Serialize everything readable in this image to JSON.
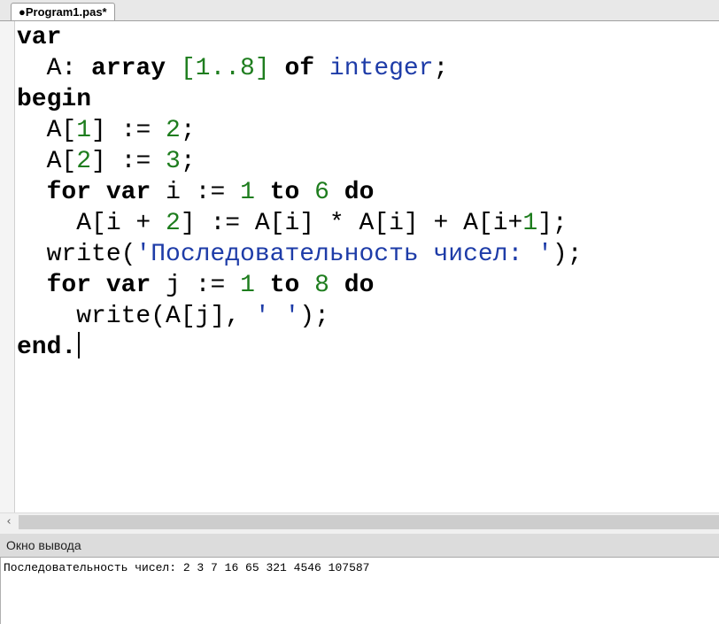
{
  "tab": {
    "title": "●Program1.pas*"
  },
  "code_lines": [
    [
      {
        "t": "var",
        "c": "kw"
      }
    ],
    [
      {
        "t": "  A: ",
        "c": ""
      },
      {
        "t": "array",
        "c": "kw"
      },
      {
        "t": " ",
        "c": ""
      },
      {
        "t": "[1..8]",
        "c": "num"
      },
      {
        "t": " ",
        "c": ""
      },
      {
        "t": "of",
        "c": "kw"
      },
      {
        "t": " ",
        "c": ""
      },
      {
        "t": "integer",
        "c": "typ"
      },
      {
        "t": ";",
        "c": ""
      }
    ],
    [
      {
        "t": "begin",
        "c": "kw"
      }
    ],
    [
      {
        "t": "  A[",
        "c": ""
      },
      {
        "t": "1",
        "c": "num"
      },
      {
        "t": "] := ",
        "c": ""
      },
      {
        "t": "2",
        "c": "num"
      },
      {
        "t": ";",
        "c": ""
      }
    ],
    [
      {
        "t": "  A[",
        "c": ""
      },
      {
        "t": "2",
        "c": "num"
      },
      {
        "t": "] := ",
        "c": ""
      },
      {
        "t": "3",
        "c": "num"
      },
      {
        "t": ";",
        "c": ""
      }
    ],
    [
      {
        "t": "  ",
        "c": ""
      },
      {
        "t": "for",
        "c": "kw"
      },
      {
        "t": " ",
        "c": ""
      },
      {
        "t": "var",
        "c": "kw"
      },
      {
        "t": " i := ",
        "c": ""
      },
      {
        "t": "1",
        "c": "num"
      },
      {
        "t": " ",
        "c": ""
      },
      {
        "t": "to",
        "c": "kw"
      },
      {
        "t": " ",
        "c": ""
      },
      {
        "t": "6",
        "c": "num"
      },
      {
        "t": " ",
        "c": ""
      },
      {
        "t": "do",
        "c": "kw"
      }
    ],
    [
      {
        "t": "    A[i + ",
        "c": ""
      },
      {
        "t": "2",
        "c": "num"
      },
      {
        "t": "] := A[i] * A[i] + A[i+",
        "c": ""
      },
      {
        "t": "1",
        "c": "num"
      },
      {
        "t": "];",
        "c": ""
      }
    ],
    [
      {
        "t": "  write(",
        "c": ""
      },
      {
        "t": "'Последовательность чисел: '",
        "c": "str"
      },
      {
        "t": ");",
        "c": ""
      }
    ],
    [
      {
        "t": "  ",
        "c": ""
      },
      {
        "t": "for",
        "c": "kw"
      },
      {
        "t": " ",
        "c": ""
      },
      {
        "t": "var",
        "c": "kw"
      },
      {
        "t": " j := ",
        "c": ""
      },
      {
        "t": "1",
        "c": "num"
      },
      {
        "t": " ",
        "c": ""
      },
      {
        "t": "to",
        "c": "kw"
      },
      {
        "t": " ",
        "c": ""
      },
      {
        "t": "8",
        "c": "num"
      },
      {
        "t": " ",
        "c": ""
      },
      {
        "t": "do",
        "c": "kw"
      }
    ],
    [
      {
        "t": "    write(A[j], ",
        "c": ""
      },
      {
        "t": "' '",
        "c": "str"
      },
      {
        "t": ");",
        "c": ""
      }
    ],
    [
      {
        "t": "end.",
        "c": "kw"
      }
    ]
  ],
  "scrollbar": {
    "left_arrow": "‹"
  },
  "output": {
    "title": "Окно вывода",
    "text": "Последовательность чисел: 2 3 7 16 65 321 4546 107587"
  },
  "colors": {
    "keyword": "#000000",
    "number": "#1e7d1e",
    "type": "#1e3ca8",
    "string": "#1e3ca8"
  }
}
